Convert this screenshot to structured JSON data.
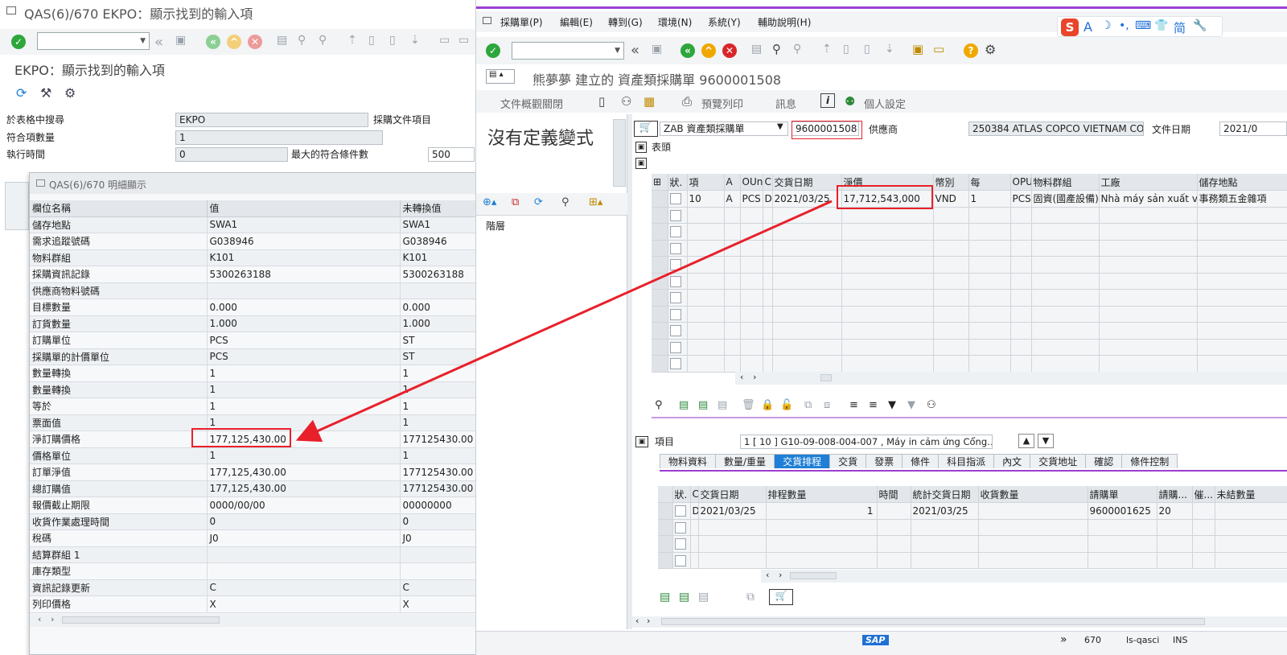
{
  "left": {
    "window_title": "QAS(6)/670 EKPO：顯示找到的輸入項",
    "screen_title": "EKPO：顯示找到的輸入項",
    "search_in_table_label": "於表格中搜尋",
    "search_in_table_value": "EKPO",
    "search_in_table_desc": "採購文件項目",
    "hits_label": "符合項數量",
    "hits_value": "1",
    "runtime_label": "執行時間",
    "runtime_value": "0",
    "max_hits_label": "最大的符合條件數",
    "max_hits_value": "500",
    "detail_title": "QAS(6)/670 明細顯示",
    "detail_headers": [
      "欄位名稱",
      "值",
      "未轉換值"
    ],
    "detail_rows": [
      [
        "儲存地點",
        "SWA1",
        "SWA1"
      ],
      [
        "需求追蹤號碼",
        "G038946",
        "G038946"
      ],
      [
        "物料群組",
        "K101",
        "K101"
      ],
      [
        "採購資訊記錄",
        "5300263188",
        "5300263188"
      ],
      [
        "供應商物料號碼",
        "",
        ""
      ],
      [
        "目標數量",
        "0.000",
        "0.000"
      ],
      [
        "訂貨數量",
        "1.000",
        "1.000"
      ],
      [
        "訂購單位",
        "PCS",
        "ST"
      ],
      [
        "採購單的計價單位",
        "PCS",
        "ST"
      ],
      [
        "數量轉換",
        "1",
        "1"
      ],
      [
        "數量轉換",
        "1",
        "1"
      ],
      [
        "等於",
        "1",
        "1"
      ],
      [
        "票面值",
        "1",
        "1"
      ],
      [
        "淨訂購價格",
        "177,125,430.00",
        "177125430.00"
      ],
      [
        "價格單位",
        "1",
        "1"
      ],
      [
        "訂單淨值",
        "177,125,430.00",
        "177125430.00"
      ],
      [
        "總訂購值",
        "177,125,430.00",
        "177125430.00"
      ],
      [
        "報價截止期限",
        "0000/00/00",
        "00000000"
      ],
      [
        "收貨作業處理時間",
        "0",
        "0"
      ],
      [
        "稅碼",
        "J0",
        "J0"
      ],
      [
        "結算群組 1",
        "",
        ""
      ],
      [
        "庫存類型",
        "",
        ""
      ],
      [
        "資訊記錄更新",
        "C",
        "C"
      ],
      [
        "列印價格",
        "X",
        "X"
      ]
    ]
  },
  "right": {
    "menu": [
      "採購單(P)",
      "編輯(E)",
      "轉到(G)",
      "環境(N)",
      "系統(Y)",
      "輔助說明(H)"
    ],
    "ime_items": [
      "A",
      "简"
    ],
    "screen_title": "熊夢夢 建立的 資產類採購單 9600001508",
    "app_toolbar": [
      "文件概觀關閉",
      "預覽列印",
      "訊息",
      "個人設定"
    ],
    "no_variant_text": "沒有定義變式",
    "hierarchy_label": "階層",
    "po_type": "ZAB 資產類採購單",
    "po_number": "9600001508",
    "vendor_label": "供應商",
    "vendor_value": "250384 ATLAS COPCO VIETNAM CO.,",
    "doc_date_label": "文件日期",
    "doc_date_value": "2021/0",
    "header_label": "表頭",
    "item_headers": [
      "狀.",
      "項",
      "A",
      "OUn",
      "C",
      "交貨日期",
      "淨價",
      "幣別",
      "每",
      "OPU",
      "物料群組",
      "工廠",
      "儲存地點"
    ],
    "item_row": [
      "",
      "10",
      "A",
      "PCS",
      "D",
      "2021/03/25",
      "17,712,543,000",
      "VND",
      "1",
      "PCS",
      "固資(國產設備)",
      "Nhà máy sản xuất việ…",
      "事務類五金雜項"
    ],
    "item_select_label": "項目",
    "item_select_value": "1 [ 10 ] G10-09-008-004-007 , Máy in  cảm ứng Cổng…",
    "tabs": [
      "物料資料",
      "數量/重量",
      "交貨排程",
      "交貨",
      "發票",
      "條件",
      "科目指派",
      "內文",
      "交貨地址",
      "確認",
      "條件控制"
    ],
    "active_tab": "交貨排程",
    "schedule_headers": [
      "狀.",
      "C",
      "交貨日期",
      "排程數量",
      "時間",
      "統計交貨日期",
      "收貨數量",
      "請購單",
      "請購...",
      "催...",
      "未結數量"
    ],
    "schedule_row": [
      "",
      "D",
      "2021/03/25",
      "1",
      "",
      "2021/03/25",
      "",
      "9600001625",
      "20",
      "",
      ""
    ],
    "status": {
      "system": "670",
      "server": "ls-qasci",
      "mode": "INS",
      "logo": "SAP"
    }
  },
  "colors": {
    "highlight": "#e8202a",
    "sap_green": "#2da63b",
    "tab_active": "#1f7fd6",
    "purple_bar": "#9c3fd0"
  }
}
